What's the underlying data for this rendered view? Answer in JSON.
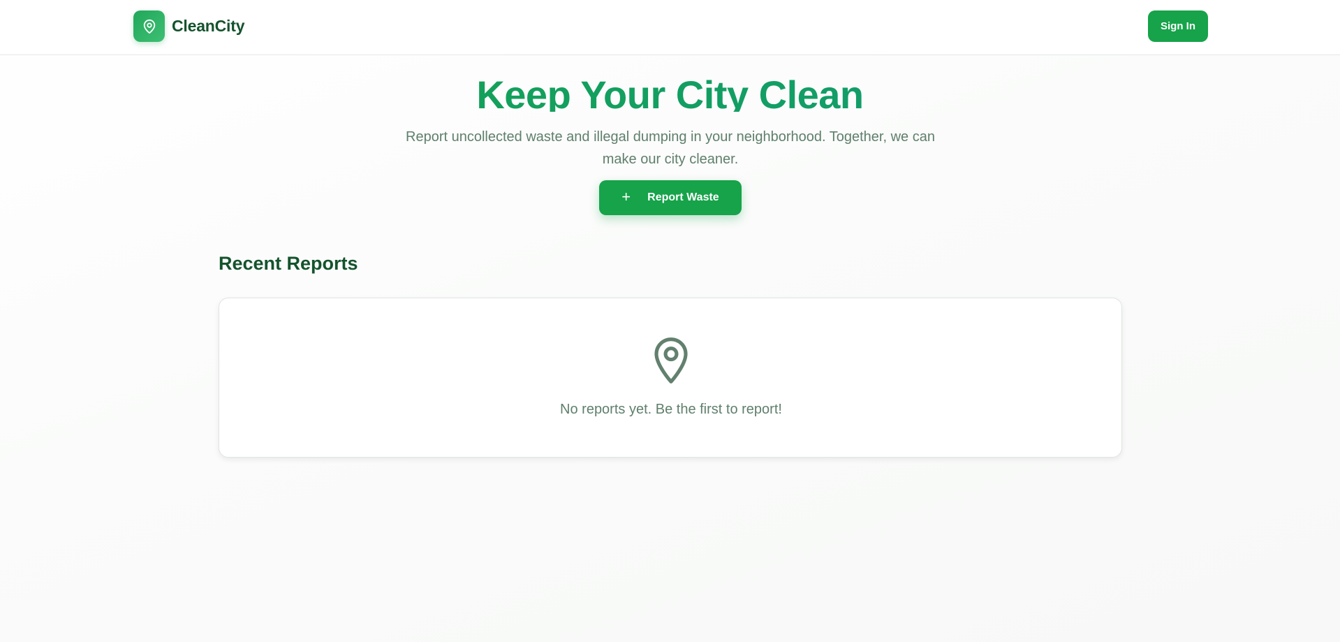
{
  "header": {
    "logo_icon": "map-pin-icon",
    "brand_name": "CleanCity",
    "signin_label": "Sign In"
  },
  "hero": {
    "title": "Keep Your City Clean",
    "subtitle": "Report uncollected waste and illegal dumping in your neighborhood. Together, we can make our city cleaner.",
    "button_icon": "plus-icon",
    "button_label": "Report Waste"
  },
  "reports": {
    "section_title": "Recent Reports",
    "empty_icon": "map-pin-icon",
    "empty_message": "No reports yet. Be the first to report!"
  },
  "colors": {
    "primary": "#16a34a",
    "title_gradient_end": "#0f9a78",
    "heading": "#14532d",
    "muted_text": "#5f7f6c"
  }
}
